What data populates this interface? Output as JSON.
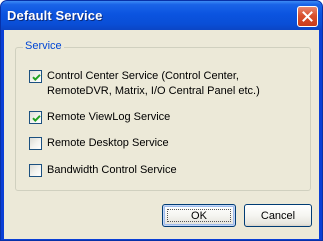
{
  "window": {
    "title": "Default Service",
    "close_icon": "close-icon",
    "colors": {
      "titlebar": "#0a4ed6",
      "close_button": "#d9502e",
      "client": "#ece9d8",
      "group_label": "#0046d5"
    }
  },
  "group": {
    "label": "Service",
    "options": [
      {
        "lines": [
          "Control Center Service (Control Center,",
          "RemoteDVR, Matrix, I/O Central Panel etc.)"
        ],
        "checked": true
      },
      {
        "lines": [
          "Remote ViewLog Service"
        ],
        "checked": true
      },
      {
        "lines": [
          "Remote Desktop Service"
        ],
        "checked": false
      },
      {
        "lines": [
          "Bandwidth Control Service"
        ],
        "checked": false
      }
    ]
  },
  "buttons": {
    "ok_label": "OK",
    "cancel_label": "Cancel"
  }
}
